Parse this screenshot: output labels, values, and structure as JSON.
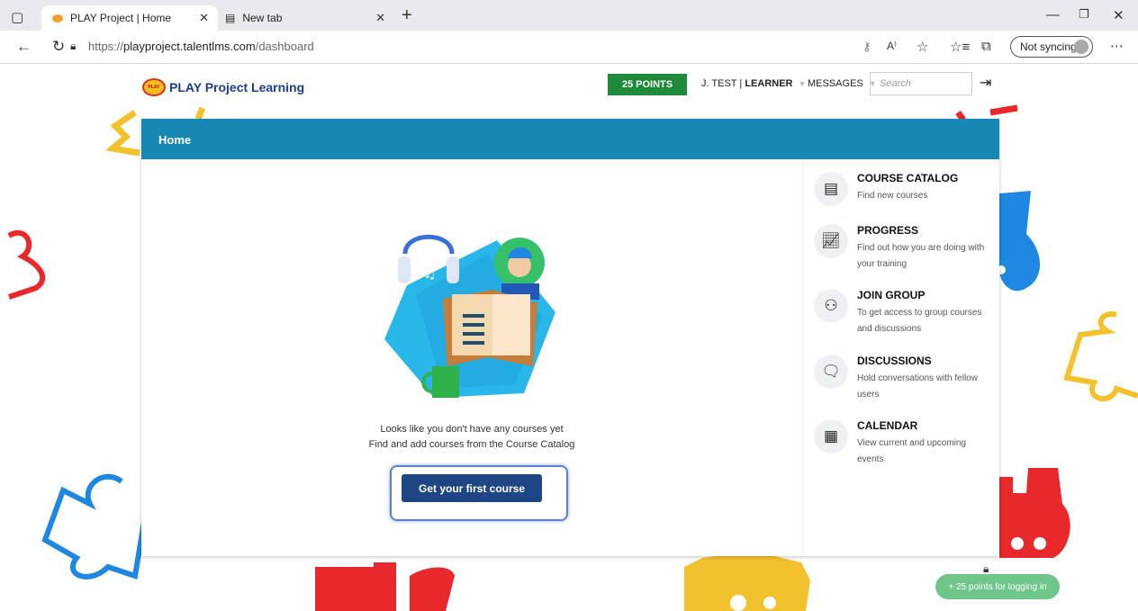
{
  "browser": {
    "tabs": [
      {
        "title": "PLAY Project | Home"
      },
      {
        "title": "New tab"
      }
    ],
    "url_prefix": "https://",
    "url_host": "playproject.talentlms.com",
    "url_path": "/dashboard",
    "sync_label": "Not syncing"
  },
  "header": {
    "logo_text": "PLAY Project Learning",
    "points": "25 POINTS",
    "user_name": "J. TEST",
    "user_role": "LEARNER",
    "messages": "MESSAGES",
    "search_placeholder": "Search"
  },
  "page": {
    "title": "Home",
    "empty_line1": "Looks like you don't have any courses yet",
    "empty_line2": "Find and add courses from the Course Catalog",
    "cta": "Get your first course"
  },
  "sidebar": {
    "items": [
      {
        "title": "COURSE CATALOG",
        "desc": "Find new courses",
        "icon": "book-icon"
      },
      {
        "title": "PROGRESS",
        "desc": "Find out how you are doing with your training",
        "icon": "progress-icon"
      },
      {
        "title": "JOIN GROUP",
        "desc": "To get access to group courses and discussions",
        "icon": "group-icon"
      },
      {
        "title": "DISCUSSIONS",
        "desc": "Hold conversations with fellow users",
        "icon": "chat-icon"
      },
      {
        "title": "CALENDAR",
        "desc": "View current and upcoming events",
        "icon": "calendar-icon"
      }
    ]
  },
  "toast": "+ 25 points for logging in",
  "colors": {
    "header_bar": "#1787b3",
    "points_badge": "#1e8a3a",
    "cta": "#1e4584",
    "toast": "#6fc68a"
  }
}
